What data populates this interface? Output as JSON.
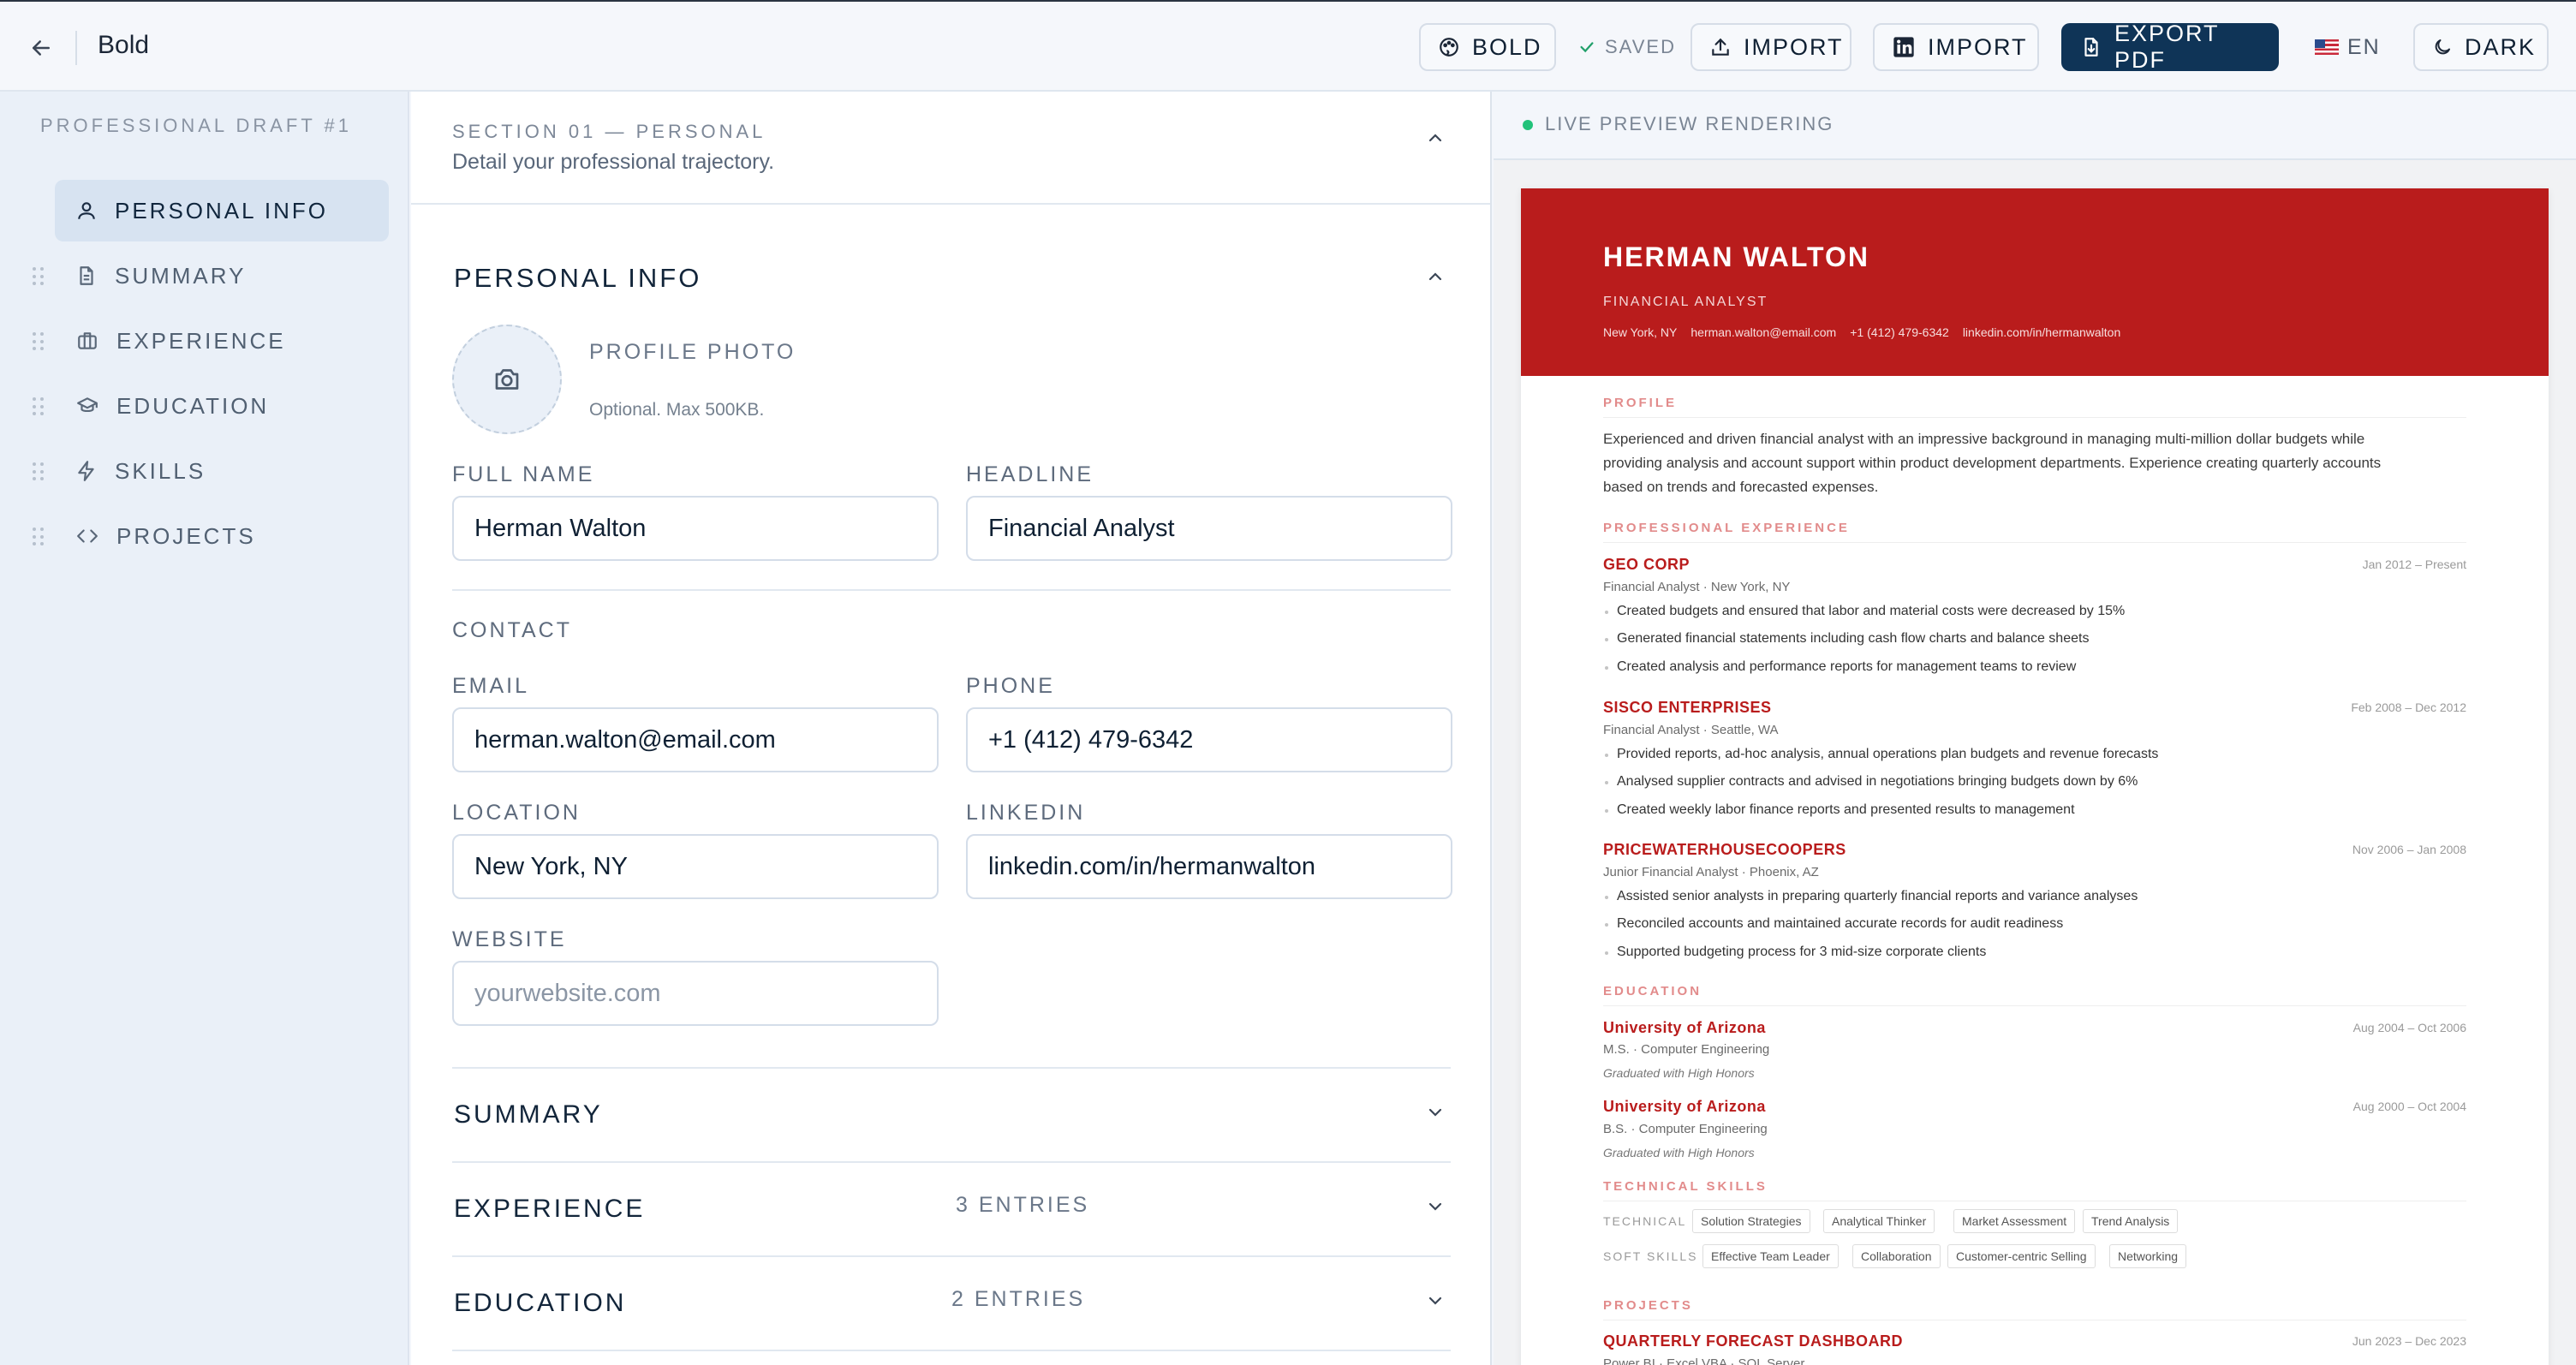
{
  "topbar": {
    "app_title": "Bold",
    "theme_label": "BOLD",
    "saved_label": "SAVED",
    "import_label": "IMPORT",
    "linkedin_import_label": "IMPORT",
    "export_label": "EXPORT PDF",
    "language_label": "EN",
    "dark_label": "DARK"
  },
  "sidebar": {
    "draft_title": "PROFESSIONAL DRAFT #1",
    "items": [
      {
        "label": "PERSONAL INFO",
        "icon": "user-icon"
      },
      {
        "label": "SUMMARY",
        "icon": "document-icon"
      },
      {
        "label": "EXPERIENCE",
        "icon": "briefcase-icon"
      },
      {
        "label": "EDUCATION",
        "icon": "graduation-cap-icon"
      },
      {
        "label": "SKILLS",
        "icon": "lightning-icon"
      },
      {
        "label": "PROJECTS",
        "icon": "code-icon"
      }
    ]
  },
  "editor": {
    "section_kicker": "SECTION 01 — PERSONAL",
    "section_subtitle": "Detail your professional trajectory.",
    "personal_title": "PERSONAL INFO",
    "photo_label": "PROFILE PHOTO",
    "photo_hint": "Optional. Max 500KB.",
    "full_name_label": "FULL NAME",
    "full_name_value": "Herman Walton",
    "headline_label": "HEADLINE",
    "headline_value": "Financial Analyst",
    "contact_label": "CONTACT",
    "email_label": "EMAIL",
    "email_value": "herman.walton@email.com",
    "phone_label": "PHONE",
    "phone_value": "+1 (412) 479-6342",
    "location_label": "LOCATION",
    "location_value": "New York, NY",
    "linkedin_label": "LINKEDIN",
    "linkedin_value": "linkedin.com/in/hermanwalton",
    "website_label": "WEBSITE",
    "website_placeholder": "yourwebsite.com",
    "summary_title": "SUMMARY",
    "experience_title": "EXPERIENCE",
    "experience_count": "3 ENTRIES",
    "education_title": "EDUCATION",
    "education_count": "2 ENTRIES"
  },
  "preview": {
    "status": "LIVE PREVIEW RENDERING",
    "accent_color": "#b91c1c",
    "name": "HERMAN WALTON",
    "title": "FINANCIAL ANALYST",
    "contact": [
      "New York, NY",
      "herman.walton@email.com",
      "+1 (412) 479-6342",
      "linkedin.com/in/hermanwalton"
    ],
    "profile_heading": "PROFILE",
    "profile_line1": "Experienced and driven financial analyst with an impressive background in managing multi-million dollar budgets while",
    "profile_line2": "providing analysis and account support within product development departments. Experience creating quarterly accounts",
    "profile_line3": "based on trends and forecasted expenses.",
    "experience_heading": "PROFESSIONAL EXPERIENCE",
    "experience": [
      {
        "company": "GEO CORP",
        "date": "Jan 2012 – Present",
        "meta": "Financial Analyst · New York, NY",
        "bullets": [
          "Created budgets and ensured that labor and material costs were decreased by 15%",
          "Generated financial statements including cash flow charts and balance sheets",
          "Created analysis and performance reports for management teams to review"
        ]
      },
      {
        "company": "SISCO ENTERPRISES",
        "date": "Feb 2008 – Dec 2012",
        "meta": "Financial Analyst · Seattle, WA",
        "bullets": [
          "Provided reports, ad-hoc analysis, annual operations plan budgets and revenue forecasts",
          "Analysed supplier contracts and advised in negotiations bringing budgets down by 6%",
          "Created weekly labor finance reports and presented results to management"
        ]
      },
      {
        "company": "PRICEWATERHOUSECOOPERS",
        "date": "Nov 2006 – Jan 2008",
        "meta": "Junior Financial Analyst · Phoenix, AZ",
        "bullets": [
          "Assisted senior analysts in preparing quarterly financial reports and variance analyses",
          "Reconciled accounts and maintained accurate records for audit readiness",
          "Supported budgeting process for 3 mid-size corporate clients"
        ]
      }
    ],
    "education_heading": "EDUCATION",
    "education": [
      {
        "school": "University of Arizona",
        "date": "Aug 2004 – Oct 2006",
        "degree": "M.S. · Computer Engineering",
        "note": "Graduated with High Honors"
      },
      {
        "school": "University of Arizona",
        "date": "Aug 2000 – Oct 2004",
        "degree": "B.S. · Computer Engineering",
        "note": "Graduated with High Honors"
      }
    ],
    "skills_heading": "TECHNICAL SKILLS",
    "technical_label": "TECHNICAL",
    "technical": [
      "Solution Strategies",
      "Analytical Thinker",
      "Market Assessment",
      "Trend Analysis"
    ],
    "soft_label": "SOFT SKILLS",
    "soft": [
      "Effective Team Leader",
      "Collaboration",
      "Customer-centric Selling",
      "Networking"
    ],
    "projects_heading": "PROJECTS",
    "project_name": "QUARTERLY FORECAST DASHBOARD",
    "project_date": "Jun 2023 – Dec 2023",
    "project_meta": "Power BI · Excel VBA · SQL Server"
  }
}
